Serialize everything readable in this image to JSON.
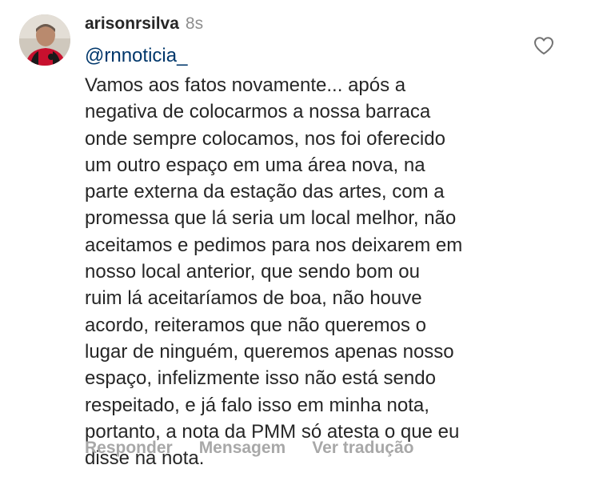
{
  "comment": {
    "username": "arisonrsilva",
    "timestamp": "8s",
    "mention": "@rnnoticia_",
    "body_lines": [
      "Vamos aos fatos novamente... após a",
      "negativa de colocarmos a nossa barraca",
      "onde sempre colocamos, nos foi oferecido",
      "um outro espaço em uma área nova, na",
      "parte externa da estação das artes, com a",
      "promessa que lá seria um local melhor, não",
      "aceitamos e pedimos para nos deixarem em",
      "nosso local anterior, que sendo bom ou",
      "ruim lá aceitaríamos de boa, não houve",
      "acordo, reiteramos que não queremos o",
      "lugar de ninguém, queremos apenas nosso",
      "espaço, infelizmente isso não está sendo",
      "respeitado, e já falo isso em minha nota,",
      "portanto, a nota da PMM só atesta o que eu",
      "disse na nota."
    ],
    "like_icon": "heart-outline-icon"
  },
  "actions": {
    "reply_label": "Responder",
    "message_label": "Mensagem",
    "translate_label": "Ver tradução"
  },
  "colors": {
    "text": "#262626",
    "muted": "#8e8e8e",
    "action": "#a8a8a8",
    "mention": "#00376b",
    "avatar_shirt_red": "#c8102e",
    "avatar_shirt_black": "#1a1a1a"
  }
}
